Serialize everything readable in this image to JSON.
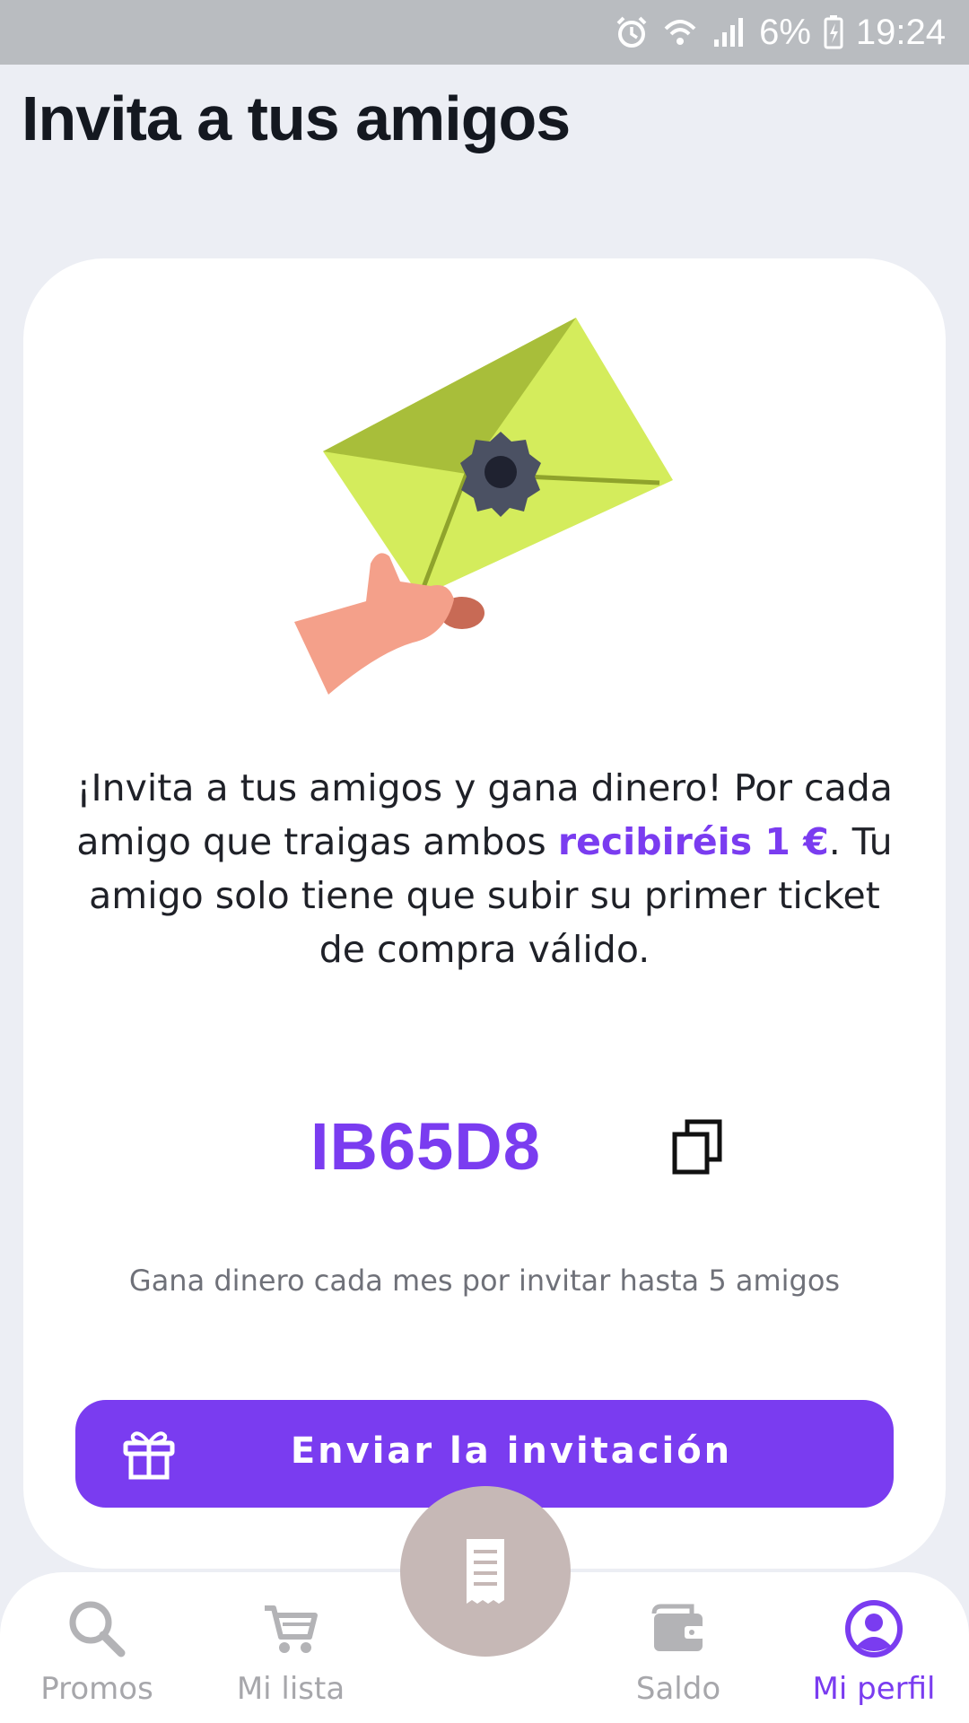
{
  "status_bar": {
    "battery": "6%",
    "time": "19:24"
  },
  "page": {
    "title": "Invita a tus amigos"
  },
  "invite": {
    "message_part1": "¡Invita a tus amigos y gana dinero! Por cada amigo que traigas ambos ",
    "message_highlight": "recibiréis 1 €",
    "message_part2": ". Tu amigo solo tiene que subir su primer ticket de compra válido.",
    "code": "IB65D8",
    "note": "Gana dinero cada mes por invitar hasta 5 amigos",
    "button_label": "Enviar la invitación"
  },
  "nav": {
    "items": [
      {
        "label": "Promos",
        "icon": "search-icon"
      },
      {
        "label": "Mi lista",
        "icon": "cart-icon"
      },
      {
        "label": "Saldo",
        "icon": "wallet-icon"
      },
      {
        "label": "Mi perfil",
        "icon": "profile-icon",
        "active": true
      }
    ],
    "center_icon": "receipt-icon"
  },
  "colors": {
    "accent": "#7a3cf0",
    "envelope": "#d4ec5c",
    "background": "#eceef4"
  }
}
